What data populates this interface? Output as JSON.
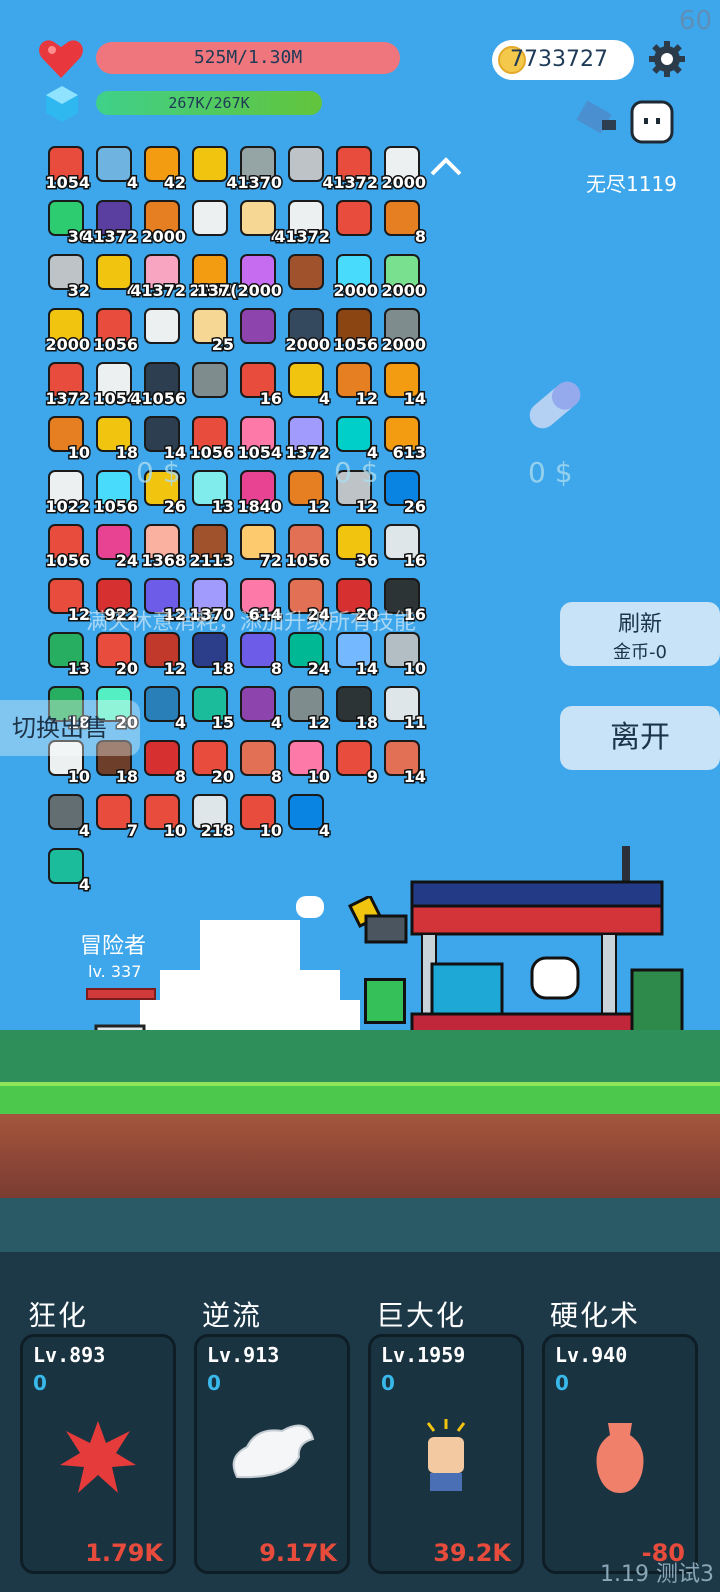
{
  "fps": "60",
  "hp": "525M/1.30M",
  "mp": "267K/267K",
  "coins": "7733727",
  "endless": "无尽1119",
  "items": [
    {
      "n": "1054",
      "c": "#e74c3c"
    },
    {
      "n": "4",
      "c": "#6fb3e0"
    },
    {
      "n": "42",
      "c": "#f39c12"
    },
    {
      "n": "",
      "c": "#f1c40f"
    },
    {
      "n": "41370",
      "c": "#95a5a6"
    },
    {
      "n": "",
      "c": "#bdc3c7"
    },
    {
      "n": "41372",
      "c": "#e74c3c"
    },
    {
      "n": "2000",
      "c": "#ecf0f1"
    },
    {
      "n": "30",
      "c": "#2ecc71"
    },
    {
      "n": "41372",
      "c": "#5b3fa0"
    },
    {
      "n": "2000",
      "c": "#e67e22"
    },
    {
      "n": "",
      "c": "#ecf0f1"
    },
    {
      "n": "4",
      "c": "#f7d794"
    },
    {
      "n": "41372",
      "c": "#ecf0f1"
    },
    {
      "n": "",
      "c": "#e74c3c"
    },
    {
      "n": "8",
      "c": "#e67e22"
    },
    {
      "n": "32",
      "c": "#bdc3c7"
    },
    {
      "n": "4",
      "c": "#f1c40f"
    },
    {
      "n": "41372",
      "c": "#f8a5c2"
    },
    {
      "n": "2000",
      "c": "#f39c12"
    },
    {
      "n": "137(2000",
      "c": "#c56cf0"
    },
    {
      "n": "",
      "c": "#a0522d"
    },
    {
      "n": "2000",
      "c": "#48dbfb"
    },
    {
      "n": "2000",
      "c": "#78e08f"
    },
    {
      "n": "2000",
      "c": "#f1c40f"
    },
    {
      "n": "1056",
      "c": "#e74c3c"
    },
    {
      "n": "",
      "c": "#ecf0f1"
    },
    {
      "n": "25",
      "c": "#f7d794"
    },
    {
      "n": "",
      "c": "#8e44ad"
    },
    {
      "n": "2000",
      "c": "#34495e"
    },
    {
      "n": "1056",
      "c": "#8b4513"
    },
    {
      "n": "2000",
      "c": "#7f8c8d"
    },
    {
      "n": "1372",
      "c": "#e74c3c"
    },
    {
      "n": "1054",
      "c": "#ecf0f1"
    },
    {
      "n": "41056",
      "c": "#2c3e50"
    },
    {
      "n": "",
      "c": "#7f8c8d"
    },
    {
      "n": "16",
      "c": "#e74c3c"
    },
    {
      "n": "4",
      "c": "#f1c40f"
    },
    {
      "n": "12",
      "c": "#e67e22"
    },
    {
      "n": "14",
      "c": "#f39c12"
    },
    {
      "n": "10",
      "c": "#e67e22"
    },
    {
      "n": "18",
      "c": "#f1c40f"
    },
    {
      "n": "14",
      "c": "#2c3e50"
    },
    {
      "n": "1056",
      "c": "#e74c3c"
    },
    {
      "n": "1054",
      "c": "#fd79a8"
    },
    {
      "n": "1372",
      "c": "#a29bfe"
    },
    {
      "n": "4",
      "c": "#00cec9"
    },
    {
      "n": "613",
      "c": "#f39c12"
    },
    {
      "n": "1022",
      "c": "#ecf0f1"
    },
    {
      "n": "1056",
      "c": "#48dbfb"
    },
    {
      "n": "26",
      "c": "#f1c40f"
    },
    {
      "n": "13",
      "c": "#81ecec"
    },
    {
      "n": "1840",
      "c": "#e84393"
    },
    {
      "n": "12",
      "c": "#e67e22"
    },
    {
      "n": "12",
      "c": "#bdc3c7"
    },
    {
      "n": "26",
      "c": "#0984e3"
    },
    {
      "n": "1056",
      "c": "#e74c3c"
    },
    {
      "n": "24",
      "c": "#e84393"
    },
    {
      "n": "1368",
      "c": "#fab1a0"
    },
    {
      "n": "2113",
      "c": "#a0522d"
    },
    {
      "n": "72",
      "c": "#fdcb6e"
    },
    {
      "n": "1056",
      "c": "#e17055"
    },
    {
      "n": "36",
      "c": "#f1c40f"
    },
    {
      "n": "16",
      "c": "#dfe6e9"
    },
    {
      "n": "12",
      "c": "#e74c3c"
    },
    {
      "n": "922",
      "c": "#d63031"
    },
    {
      "n": "12",
      "c": "#6c5ce7"
    },
    {
      "n": "1370",
      "c": "#a29bfe"
    },
    {
      "n": "614",
      "c": "#fd79a8"
    },
    {
      "n": "24",
      "c": "#e17055"
    },
    {
      "n": "20",
      "c": "#d63031"
    },
    {
      "n": "16",
      "c": "#2d3436"
    },
    {
      "n": "13",
      "c": "#27ae60"
    },
    {
      "n": "20",
      "c": "#e74c3c"
    },
    {
      "n": "12",
      "c": "#c0392b"
    },
    {
      "n": "18",
      "c": "#2c3e8a"
    },
    {
      "n": "8",
      "c": "#6c5ce7"
    },
    {
      "n": "24",
      "c": "#00b894"
    },
    {
      "n": "14",
      "c": "#74b9ff"
    },
    {
      "n": "10",
      "c": "#b2bec3"
    },
    {
      "n": "18",
      "c": "#27ae60"
    },
    {
      "n": "20",
      "c": "#55efc4"
    },
    {
      "n": "4",
      "c": "#2980b9"
    },
    {
      "n": "15",
      "c": "#1abc9c"
    },
    {
      "n": "4",
      "c": "#8e44ad"
    },
    {
      "n": "12",
      "c": "#7f8c8d"
    },
    {
      "n": "18",
      "c": "#2d3436"
    },
    {
      "n": "11",
      "c": "#dfe6e9"
    },
    {
      "n": "10",
      "c": "#ecf0f1"
    },
    {
      "n": "18",
      "c": "#6d3f2a"
    },
    {
      "n": "8",
      "c": "#d63031"
    },
    {
      "n": "20",
      "c": "#e74c3c"
    },
    {
      "n": "8",
      "c": "#e17055"
    },
    {
      "n": "10",
      "c": "#fd79a8"
    },
    {
      "n": "9",
      "c": "#e74c3c"
    },
    {
      "n": "14",
      "c": "#e17055"
    },
    {
      "n": "4",
      "c": "#636e72"
    },
    {
      "n": "7",
      "c": "#e74c3c"
    },
    {
      "n": "10",
      "c": "#e74c3c"
    },
    {
      "n": "218",
      "c": "#dfe6e9"
    },
    {
      "n": "10",
      "c": "#e74c3c"
    },
    {
      "n": "4",
      "c": "#0984e3"
    },
    {
      "n": "",
      "c": ""
    },
    {
      "n": "",
      "c": ""
    },
    {
      "n": "4",
      "c": "#1abc9c"
    }
  ],
  "shop": {
    "price1": "0 $",
    "price2": "0 $",
    "price3": "0 $",
    "refresh": "刷新",
    "refresh_cost": "金币-0",
    "leave": "离开"
  },
  "switch_label": "切换出售",
  "ghost_text": "满天休意消耗，添加升级所有技能",
  "player": {
    "name": "冒险者",
    "level": "lv. 337"
  },
  "skills": [
    {
      "name": "狂化",
      "lv": "Lv.893",
      "val": "0",
      "cost": "1.79K"
    },
    {
      "name": "逆流",
      "lv": "Lv.913",
      "val": "0",
      "cost": "9.17K"
    },
    {
      "name": "巨大化",
      "lv": "Lv.1959",
      "val": "0",
      "cost": "39.2K"
    },
    {
      "name": "硬化术",
      "lv": "Lv.940",
      "val": "0",
      "cost": "-80"
    }
  ],
  "version": "1.19 测试3"
}
